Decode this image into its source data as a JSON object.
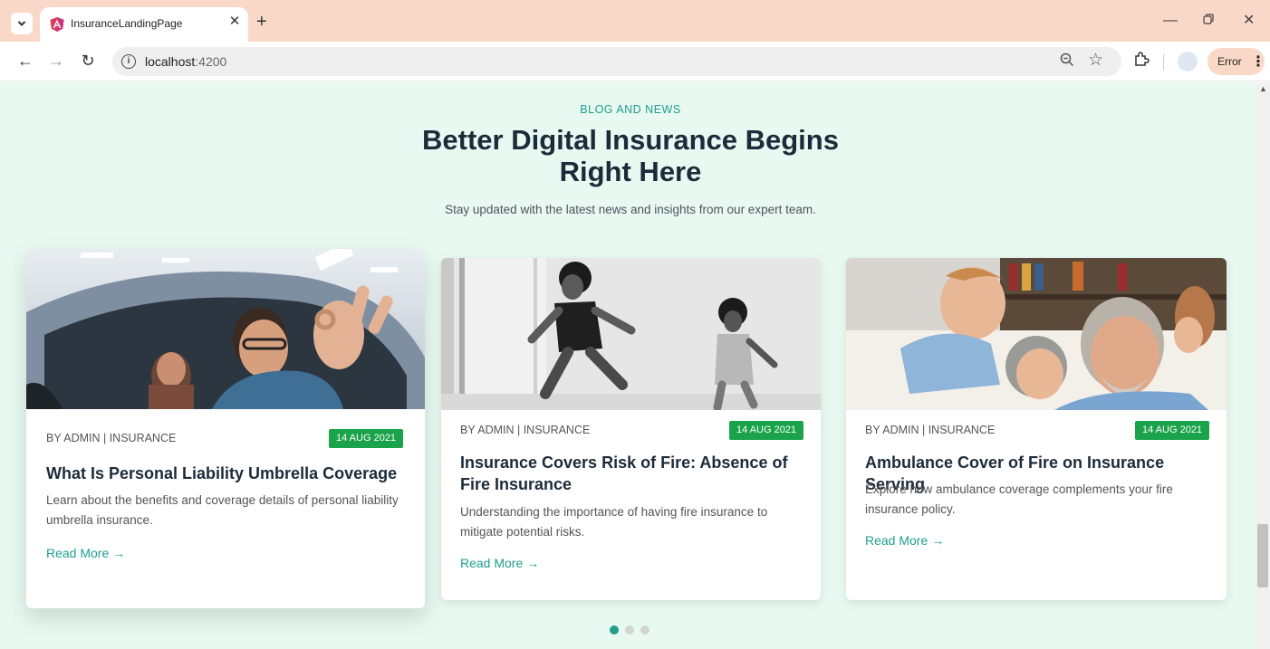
{
  "browser": {
    "tab_title": "InsuranceLandingPage",
    "url_host": "localhost",
    "url_port": ":4200",
    "error_label": "Error"
  },
  "section": {
    "eyebrow": "BLOG AND NEWS",
    "heading_line1": "Better Digital Insurance Begins",
    "heading_line2": "Right Here",
    "subtext": "Stay updated with the latest news and insights from our expert team."
  },
  "posts": [
    {
      "meta": "BY ADMIN | INSURANCE",
      "date": "14 AUG 2021",
      "title": "What Is Personal Liability Umbrella Coverage",
      "description": "Learn about the benefits and coverage details of personal liability umbrella insurance.",
      "read_more": "Read More"
    },
    {
      "meta": "BY ADMIN | INSURANCE",
      "date": "14 AUG 2021",
      "title": "Insurance Covers Risk of Fire: Absence of Fire Insurance",
      "description": "Understanding the importance of having fire insurance to mitigate potential risks.",
      "read_more": "Read More"
    },
    {
      "meta": "BY ADMIN | INSURANCE",
      "date": "14 AUG 2021",
      "title": "Ambulance Cover of Fire on Insurance Serving",
      "description": "Explore how ambulance coverage complements your fire insurance policy.",
      "read_more": "Read More"
    }
  ],
  "carousel": {
    "page_count": 3,
    "active_index": 0
  },
  "colors": {
    "accent": "#1f9e8f",
    "badge": "#1aa34a",
    "section_bg": "#e8f9f1",
    "tabstrip": "#f9d8c8"
  }
}
